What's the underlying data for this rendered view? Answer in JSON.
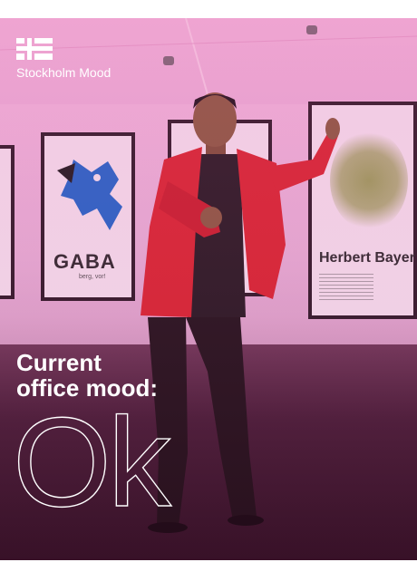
{
  "brand": {
    "name": "Stockholm Mood",
    "logo_icon": "flag-icon"
  },
  "mood": {
    "label_line1": "Current",
    "label_line2": "office mood:",
    "value": "Ok"
  },
  "photo": {
    "posters": {
      "gaba_title": "GABA",
      "gaba_subtitle": "berg, vor!",
      "bayer_title": "Herbert Bayer"
    }
  },
  "colors": {
    "tint": "#e34fad",
    "text": "#ffffff"
  }
}
